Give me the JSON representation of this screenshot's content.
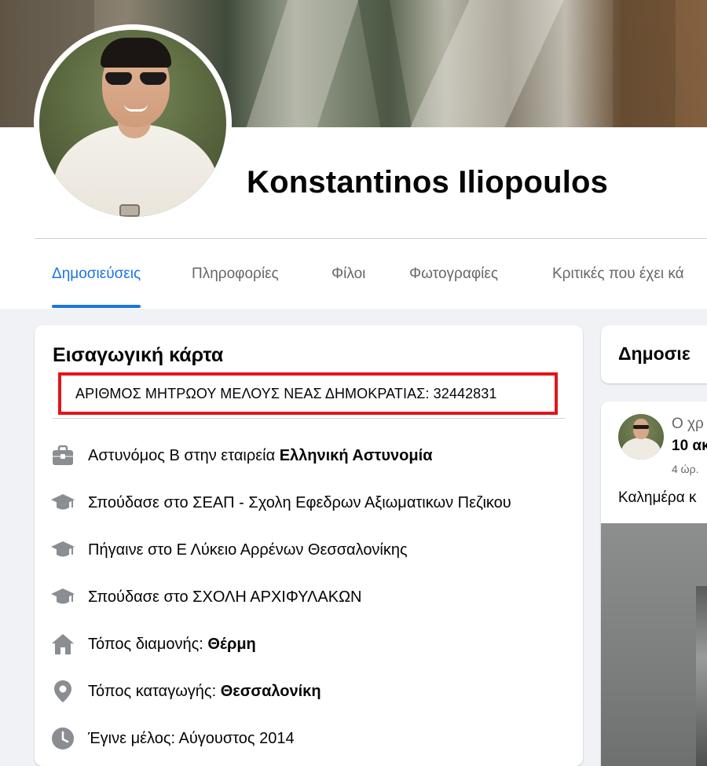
{
  "profile": {
    "name": "Konstantinos Iliopoulos"
  },
  "tabs": [
    {
      "label": "Δημοσιεύσεις",
      "active": true
    },
    {
      "label": "Πληροφορίες",
      "active": false
    },
    {
      "label": "Φίλοι",
      "active": false
    },
    {
      "label": "Φωτογραφίες",
      "active": false
    },
    {
      "label": "Κριτικές που έχει κά",
      "active": false
    }
  ],
  "intro": {
    "title": "Εισαγωγική κάρτα",
    "highlighted_text": "ΑΡΙΘΜΟΣ ΜΗΤΡΩΟΥ ΜΕΛΟΥΣ ΝΕΑΣ ΔΗΜΟΚΡΑΤΙΑΣ: 32442831",
    "highlight_color": "#e3141b",
    "items": [
      {
        "icon": "briefcase-icon",
        "text": "Αστυνόμος Β στην εταιρεία ",
        "bold": "Ελληνική Αστυνομία"
      },
      {
        "icon": "graduation-cap-icon",
        "text": "Σπούδασε στο ΣΕΑΠ - Σχολη Εφεδρων Αξιωματικων Πεζικου",
        "bold": ""
      },
      {
        "icon": "graduation-cap-icon",
        "text": "Πήγαινε στο Ε Λύκειο Αρρένων Θεσσαλονίκης",
        "bold": ""
      },
      {
        "icon": "graduation-cap-icon",
        "text": "Σπούδασε στο ΣΧΟΛΗ ΑΡΧΙΦΥΛΑΚΩΝ",
        "bold": ""
      },
      {
        "icon": "home-icon",
        "text": "Τόπος διαμονής: ",
        "bold": "Θέρμη"
      },
      {
        "icon": "location-pin-icon",
        "text": "Τόπος καταγωγής: ",
        "bold": "Θεσσαλονίκη"
      },
      {
        "icon": "clock-icon",
        "text": "Έγινε μέλος: Αύγουστος 2014",
        "bold": ""
      }
    ]
  },
  "posts": {
    "header": "Δημοσιε",
    "first_post": {
      "author": "Ο χρ",
      "date": "10 ακ",
      "time": "4 ώρ.",
      "body": "Καλημέρα κ"
    }
  },
  "colors": {
    "accent": "#1b74e4",
    "icon_gray": "#65676b",
    "page_bg": "#f0f2f5"
  }
}
